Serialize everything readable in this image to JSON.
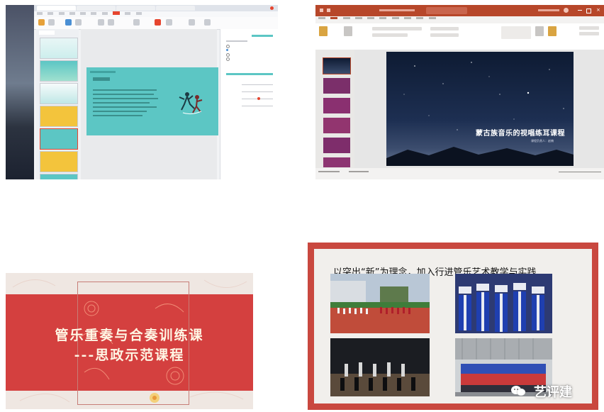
{
  "panel1": {
    "app": "wps-presentation",
    "tabs": [
      "",
      "",
      "",
      ""
    ],
    "menu": [
      "",
      "",
      "",
      "",
      "",
      "",
      "",
      "",
      "",
      "",
      ""
    ],
    "active_menu_index": 7,
    "thumbnail_count": 7,
    "selected_thumbnail": 4,
    "accent_color": "#e6452f",
    "slide_color": "#5cc6c4"
  },
  "panel2": {
    "app": "powerpoint",
    "title_color": "#b7472a",
    "slide": {
      "title": "蒙古族音乐的视唱练耳课程",
      "subtitle": "课程负责人：赵楠"
    },
    "thumbnail_count": 6,
    "selected_thumbnail": 1
  },
  "panel3": {
    "title_line1": "管乐重奏与合奏训练课",
    "title_line2": "---思政示范课程",
    "band_color": "#d4403f"
  },
  "panel4": {
    "heading": "以突出“新”为理念，加入行进管乐艺术教学与实践",
    "watermark": "艺评建",
    "watermark_icon": "wechat-icon",
    "border_color": "#c9483f"
  }
}
